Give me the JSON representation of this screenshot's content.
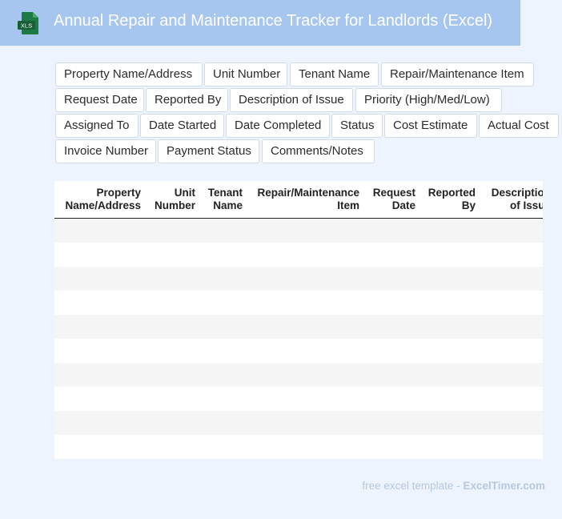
{
  "header": {
    "title": "Annual Repair and Maintenance Tracker for Landlords (Excel)",
    "icon_name": "xls-file-icon",
    "icon_label": "XLS",
    "background_color": "#a6c6f0",
    "icon_color": "#1e7a45"
  },
  "field_chips": [
    "Property Name/Address",
    "Unit Number",
    "Tenant Name",
    "Repair/Maintenance Item",
    "Request Date",
    "Reported By",
    "Description of Issue",
    "Priority (High/Med/Low)",
    "Assigned To",
    "Date Started",
    "Date Completed",
    "Status",
    "Cost Estimate",
    "Actual Cost",
    "Invoice Number",
    "Payment Status",
    "Comments/Notes"
  ],
  "table": {
    "columns": [
      "Property\nName/Address",
      "Unit\nNumber",
      "Tenant\nName",
      "Repair/Maintenance\nItem",
      "Request\nDate",
      "Reported\nBy",
      "Description\nof Issue"
    ],
    "row_count": 10
  },
  "footer": {
    "prefix": "free excel template - ",
    "brand": "ExcelTimer.com"
  }
}
